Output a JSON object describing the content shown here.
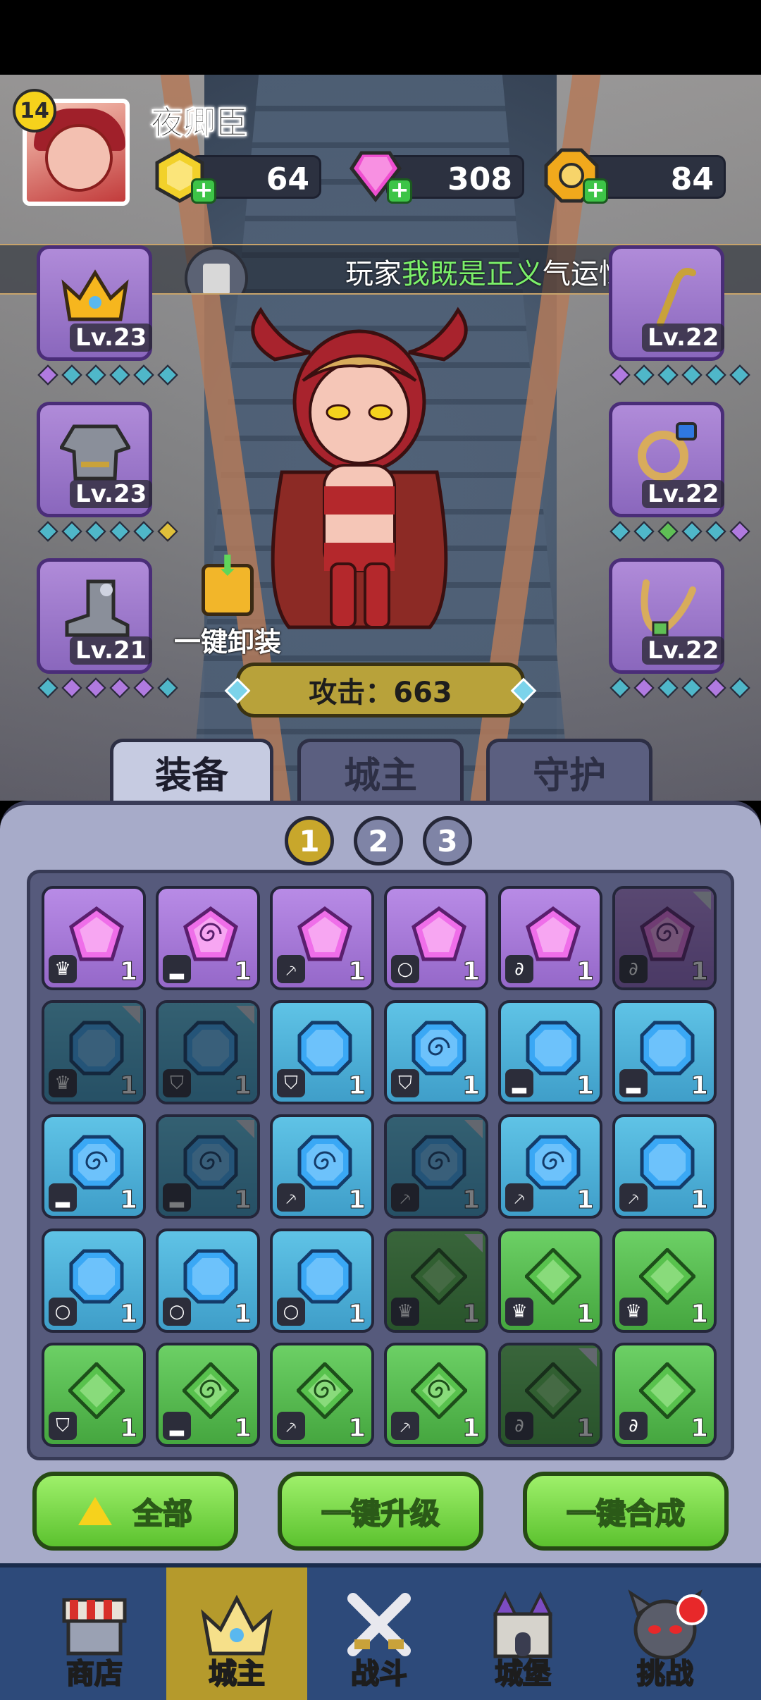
{
  "player": {
    "level": "14",
    "name": "夜卿臣"
  },
  "currencies": [
    {
      "icon": "gold-gem-icon",
      "value": "64"
    },
    {
      "icon": "pink-crystal-icon",
      "value": "308"
    },
    {
      "icon": "gold-coin-icon",
      "value": "84"
    }
  ],
  "ticker": {
    "prefix": "玩家",
    "highlight": "我既是正义",
    "suffix": "气运惊人，璀"
  },
  "equipment": {
    "left": [
      {
        "item": "crown",
        "level": "Lv.23"
      },
      {
        "item": "armor",
        "level": "Lv.23"
      },
      {
        "item": "boots",
        "level": "Lv.21"
      }
    ],
    "right": [
      {
        "item": "staff",
        "level": "Lv.22"
      },
      {
        "item": "ring",
        "level": "Lv.22"
      },
      {
        "item": "necklace",
        "level": "Lv.22"
      }
    ]
  },
  "unequip_label": "一键卸装",
  "attack_text": "攻击：663",
  "tabs": [
    "装备",
    "城主",
    "守护"
  ],
  "pages": [
    "1",
    "2",
    "3"
  ],
  "inventory": [
    {
      "color": "purple",
      "slot": "crown",
      "count": "1",
      "dim": false,
      "swirl": false
    },
    {
      "color": "purple",
      "slot": "boots",
      "count": "1",
      "dim": false,
      "swirl": true
    },
    {
      "color": "purple",
      "slot": "staff",
      "count": "1",
      "dim": false,
      "swirl": false
    },
    {
      "color": "purple",
      "slot": "ring",
      "count": "1",
      "dim": false,
      "swirl": false
    },
    {
      "color": "purple",
      "slot": "necklace",
      "count": "1",
      "dim": false,
      "swirl": false
    },
    {
      "color": "purple",
      "slot": "necklace",
      "count": "1",
      "dim": true,
      "swirl": true
    },
    {
      "color": "blue",
      "slot": "crown",
      "count": "1",
      "dim": true,
      "swirl": false
    },
    {
      "color": "blue",
      "slot": "armor",
      "count": "1",
      "dim": true,
      "swirl": false
    },
    {
      "color": "blue",
      "slot": "armor",
      "count": "1",
      "dim": false,
      "swirl": false
    },
    {
      "color": "blue",
      "slot": "armor",
      "count": "1",
      "dim": false,
      "swirl": true
    },
    {
      "color": "blue",
      "slot": "boots",
      "count": "1",
      "dim": false,
      "swirl": false
    },
    {
      "color": "blue",
      "slot": "boots",
      "count": "1",
      "dim": false,
      "swirl": false
    },
    {
      "color": "blue",
      "slot": "boots",
      "count": "1",
      "dim": false,
      "swirl": true
    },
    {
      "color": "blue",
      "slot": "boots",
      "count": "1",
      "dim": true,
      "swirl": true
    },
    {
      "color": "blue",
      "slot": "staff",
      "count": "1",
      "dim": false,
      "swirl": true
    },
    {
      "color": "blue",
      "slot": "staff",
      "count": "1",
      "dim": true,
      "swirl": true
    },
    {
      "color": "blue",
      "slot": "staff",
      "count": "1",
      "dim": false,
      "swirl": true
    },
    {
      "color": "blue",
      "slot": "staff",
      "count": "1",
      "dim": false,
      "swirl": false
    },
    {
      "color": "blue",
      "slot": "ring",
      "count": "1",
      "dim": false,
      "swirl": false
    },
    {
      "color": "blue",
      "slot": "ring",
      "count": "1",
      "dim": false,
      "swirl": false
    },
    {
      "color": "blue",
      "slot": "ring",
      "count": "1",
      "dim": false,
      "swirl": false
    },
    {
      "color": "green",
      "slot": "crown",
      "count": "1",
      "dim": true,
      "swirl": false
    },
    {
      "color": "green",
      "slot": "crown",
      "count": "1",
      "dim": false,
      "swirl": false
    },
    {
      "color": "green",
      "slot": "crown",
      "count": "1",
      "dim": false,
      "swirl": false
    },
    {
      "color": "green",
      "slot": "armor",
      "count": "1",
      "dim": false,
      "swirl": false
    },
    {
      "color": "green",
      "slot": "boots",
      "count": "1",
      "dim": false,
      "swirl": true
    },
    {
      "color": "green",
      "slot": "staff",
      "count": "1",
      "dim": false,
      "swirl": true
    },
    {
      "color": "green",
      "slot": "staff",
      "count": "1",
      "dim": false,
      "swirl": true
    },
    {
      "color": "green",
      "slot": "necklace",
      "count": "1",
      "dim": true,
      "swirl": false
    },
    {
      "color": "green",
      "slot": "necklace",
      "count": "1",
      "dim": false,
      "swirl": false
    }
  ],
  "actions": {
    "all": "全部",
    "upgrade": "一键升级",
    "merge": "一键合成"
  },
  "nav": [
    {
      "label": "商店",
      "icon": "shop-icon"
    },
    {
      "label": "城主",
      "icon": "crown-icon"
    },
    {
      "label": "战斗",
      "icon": "crossed-swords-icon"
    },
    {
      "label": "城堡",
      "icon": "castle-icon"
    },
    {
      "label": "挑战",
      "icon": "demon-helmet-icon"
    }
  ]
}
